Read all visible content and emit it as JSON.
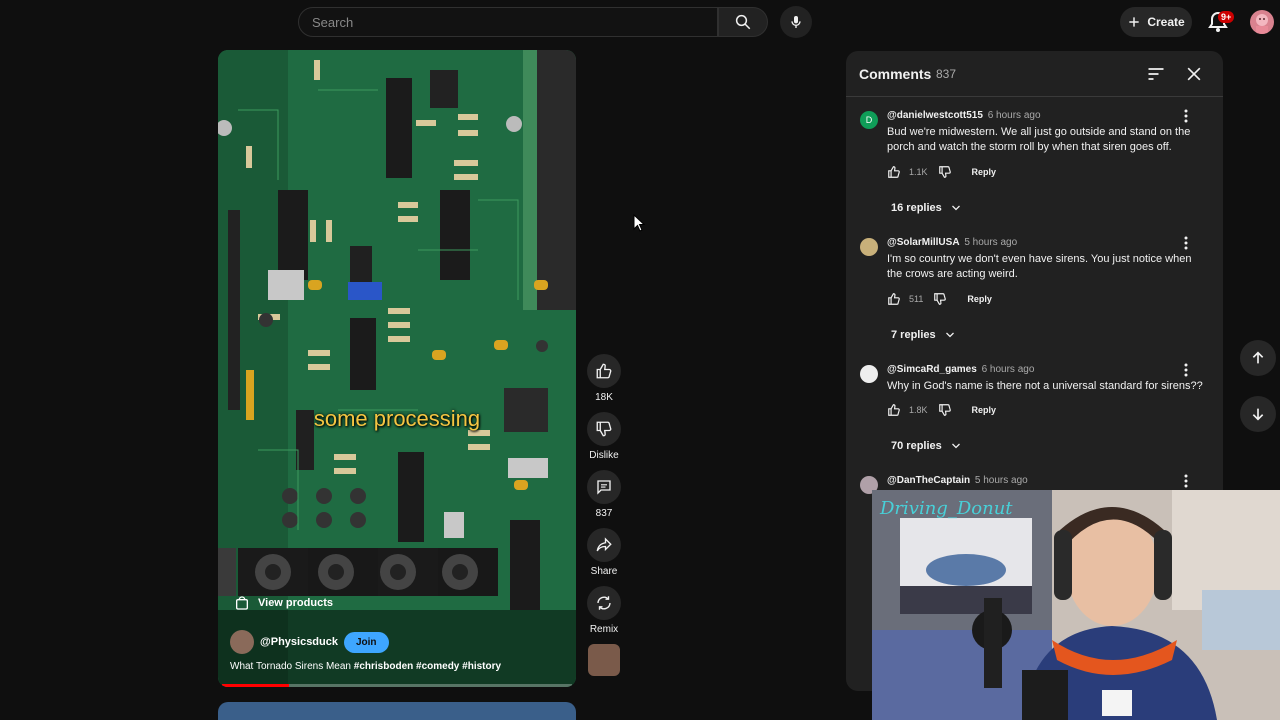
{
  "topbar": {
    "search_placeholder": "Search",
    "search_icon": "search-icon",
    "mic_icon": "microphone-icon",
    "create_label": "Create",
    "notifications_badge": "9+"
  },
  "video": {
    "caption": "some processing",
    "view_products_label": "View products",
    "channel_name": "@Physicsduck",
    "join_label": "Join",
    "title": "What Tornado Sirens Mean",
    "hashtags": "#chrisboden #comedy #history",
    "progress_fraction": 0.19
  },
  "actions": {
    "like_count": "18K",
    "dislike_label": "Dislike",
    "comments_count": "837",
    "share_label": "Share",
    "remix_label": "Remix"
  },
  "comments_panel": {
    "title": "Comments",
    "count": "837",
    "items": [
      {
        "avatar_letter": "D",
        "avatar_color": "#0f9d58",
        "author": "@danielwestcott515",
        "time": "6 hours ago",
        "text": "Bud we're midwestern. We all just go outside and stand on the porch and watch the storm roll by when that siren goes off.",
        "likes": "1.1K",
        "reply_label": "Reply",
        "replies": "16 replies"
      },
      {
        "avatar_letter": "",
        "avatar_color": "#c8b07a",
        "author": "@SolarMillUSA",
        "time": "5 hours ago",
        "text": "I'm so country we don't even have sirens. You just notice when the crows are acting weird.",
        "likes": "511",
        "reply_label": "Reply",
        "replies": "7 replies"
      },
      {
        "avatar_letter": "",
        "avatar_color": "#eeeeee",
        "author": "@SimcaRd_games",
        "time": "6 hours ago",
        "text": "Why in God's name is there not a universal standard for sirens??",
        "likes": "1.8K",
        "reply_label": "Reply",
        "replies": "70 replies"
      },
      {
        "avatar_letter": "",
        "avatar_color": "#b0a0a8",
        "author": "@DanTheCaptain",
        "time": "5 hours ago",
        "text": "",
        "likes": "",
        "reply_label": "",
        "replies": ""
      }
    ]
  },
  "webcam": {
    "overlay_text": "Driving_Donut"
  }
}
